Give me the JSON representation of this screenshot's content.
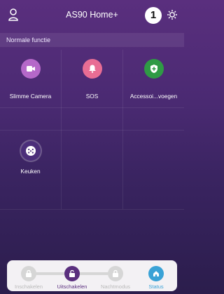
{
  "header": {
    "title": "AS90 Home+",
    "badge": "1"
  },
  "section": {
    "label": "Normale functie"
  },
  "tiles": [
    {
      "label": "Slimme Camera",
      "icon": "video-camera-icon",
      "color": "#b568c9"
    },
    {
      "label": "SOS",
      "icon": "bell-icon",
      "color": "#e86d94"
    },
    {
      "label": "Accessoi...voegen",
      "icon": "shield-plus-icon",
      "color": "#2f9a45"
    },
    {
      "label": "Keuken",
      "icon": "outlet-icon",
      "color": "#4b2e7a"
    }
  ],
  "modes": [
    {
      "label": "Inschakelen"
    },
    {
      "label": "Uitschakelen"
    },
    {
      "label": "Nachtmodus"
    },
    {
      "label": "Status"
    }
  ],
  "colors": {
    "accent": "#5a2f7e",
    "status": "#3aa2d6"
  }
}
